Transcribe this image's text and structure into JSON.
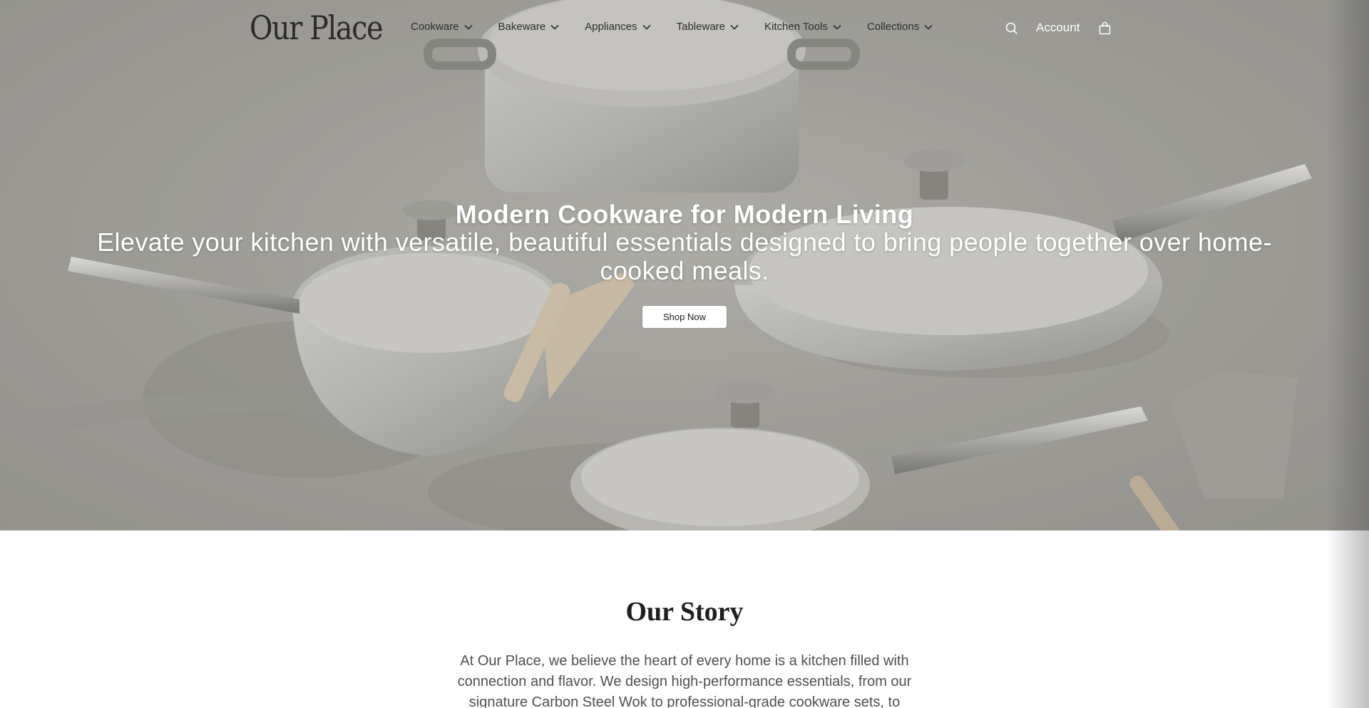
{
  "brand": {
    "logo_text": "Our Place"
  },
  "nav": {
    "items": [
      {
        "label": "Cookware"
      },
      {
        "label": "Bakeware"
      },
      {
        "label": "Appliances"
      },
      {
        "label": "Tableware"
      },
      {
        "label": "Kitchen Tools"
      },
      {
        "label": "Collections"
      }
    ],
    "account_label": "Account",
    "icons": {
      "search": "search-icon",
      "cart": "shopping-bag-icon",
      "dropdown": "chevron-down-icon"
    }
  },
  "hero": {
    "title": "Modern Cookware for Modern Living",
    "subtitle": "Elevate your kitchen with versatile, beautiful essentials designed to bring people together over home-cooked meals.",
    "cta_label": "Shop Now",
    "image": "cookware-set-photo"
  },
  "story": {
    "heading": "Our Story",
    "body": "At Our Place, we believe the heart of every home is a kitchen filled with connection and flavor. We design high-performance essentials, from our signature Carbon Steel Wok to professional-grade cookware sets, to simplify"
  },
  "colors": {
    "hero_overlay": "#9b9994",
    "text_dark": "#2e2d2b",
    "white": "#ffffff",
    "body_text": "#4f4f4f"
  }
}
